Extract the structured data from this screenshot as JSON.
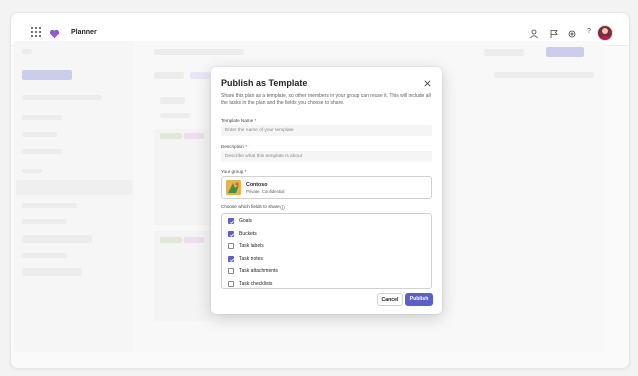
{
  "app": {
    "name": "Planner",
    "brand_color": "#7b5cd6",
    "topbar_icons": [
      "people-icon",
      "flag-icon",
      "gear-icon",
      "help-icon"
    ],
    "help_glyph": "?"
  },
  "dialog": {
    "title": "Publish as Template",
    "description": "Share this plan as a template, so other members in your group can reuse it. This will include all the tasks in the plan and the fields you choose to share.",
    "template_name": {
      "label": "Template Name",
      "required_mark": "*",
      "placeholder": "Enter the name of your template"
    },
    "description_field": {
      "label": "Description",
      "required_mark": "*",
      "placeholder": "Describe what this template is about"
    },
    "group": {
      "label": "Your group",
      "required_mark": "*",
      "name": "Contoso",
      "subtitle": "Private, Confidential"
    },
    "fields_label": "Choose which fields to share",
    "fields": [
      {
        "label": "Goals",
        "checked": true
      },
      {
        "label": "Buckets",
        "checked": true
      },
      {
        "label": "Task labels",
        "checked": false
      },
      {
        "label": "Task notes",
        "checked": true
      },
      {
        "label": "Task attachments",
        "checked": false
      },
      {
        "label": "Task checklists",
        "checked": false
      }
    ],
    "cancel_label": "Cancel",
    "publish_label": "Publish",
    "accent_color": "#5b5fc7"
  }
}
